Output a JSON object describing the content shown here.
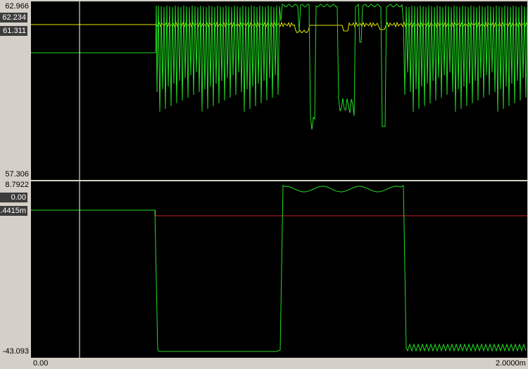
{
  "top_plot": {
    "y_max_label": "62.966",
    "y_min_label": "57.306",
    "readout_1": "62.234",
    "readout_2": "61.311"
  },
  "bottom_plot": {
    "y_max_label": "8.7922",
    "y_min_label": "-43.093",
    "readout_1": "0.00",
    "readout_2": ".4415m"
  },
  "x_axis": {
    "start_label": "0.00",
    "end_label": "2.0000m"
  },
  "colors": {
    "plot_background": "#000000",
    "trace_green": "#22dd22",
    "trace_yellow": "#e6e600",
    "trace_red": "#cc2222",
    "cursor": "#ffffff",
    "frame": "#d4d0c8"
  }
}
